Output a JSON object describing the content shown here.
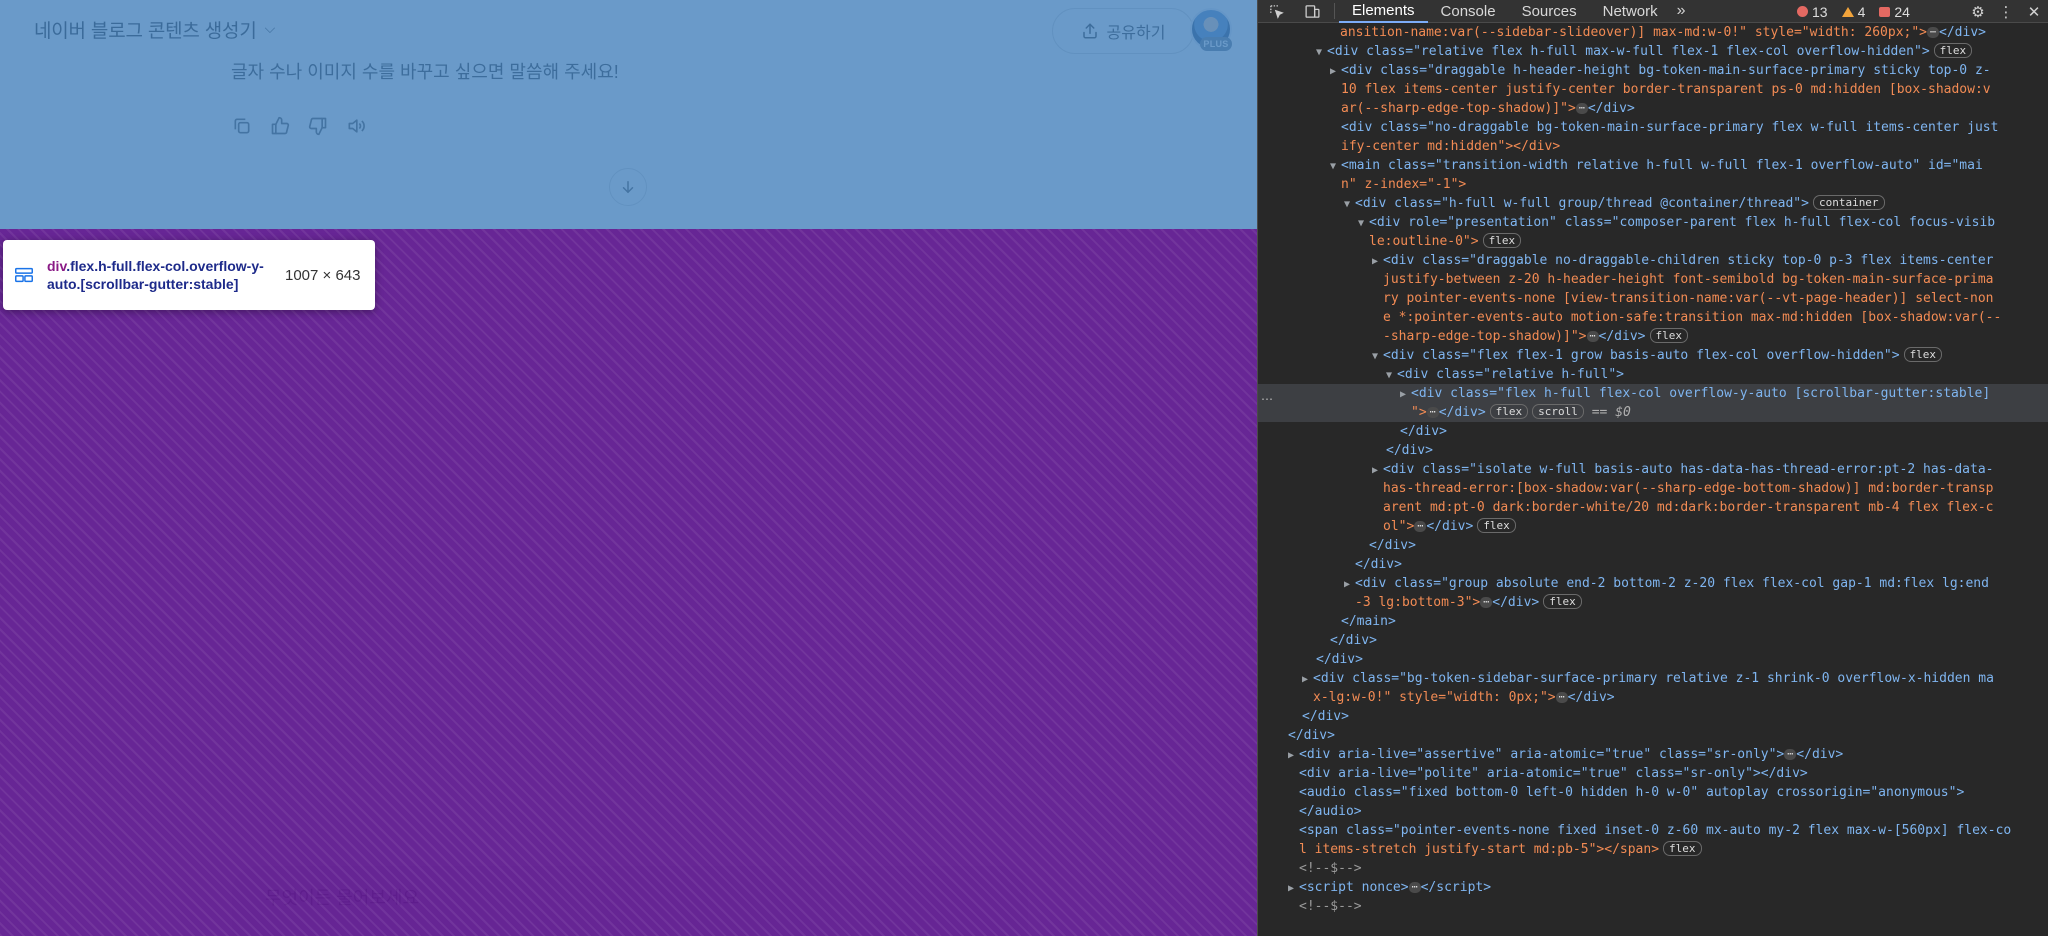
{
  "app": {
    "title": "네이버 블로그 콘텐츠 생성기",
    "share_label": "공유하기",
    "plan_badge": "PLUS",
    "assistant_message": "글자 수나 이미지 수를 바꾸고 싶으면 말씀해 주세요!",
    "composer_placeholder": "무엇이든 물어보세요"
  },
  "inspect_tooltip": {
    "tag": "div",
    "selector": ".flex.h-full.flex-col.overflow-y-auto.[scrollbar-gutter:stable]",
    "size": "1007 × 643"
  },
  "devtools": {
    "tabs": [
      "Elements",
      "Console",
      "Sources",
      "Network"
    ],
    "active_tab": "Elements",
    "errors": "13",
    "warnings": "4",
    "issues": "24",
    "selected_marker": "== $0",
    "dom_lines": [
      "ansition-name:var(--sidebar-slideover)] max-md:w-0!\" style=\"width: 260px;\">",
      "<div class=\"relative flex h-full max-w-full flex-1 flex-col overflow-hidden\">",
      "<div class=\"draggable h-header-height bg-token-main-surface-primary sticky top-0 z-",
      "10 flex items-center justify-center border-transparent ps-0 md:hidden [box-shadow:v",
      "ar(--sharp-edge-top-shadow)]\">",
      "<div class=\"no-draggable bg-token-main-surface-primary flex w-full items-center just",
      "ify-center md:hidden\"></div>",
      "<main class=\"transition-width relative h-full w-full flex-1 overflow-auto\" id=\"mai",
      "n\" z-index=\"-1\">",
      "<div class=\"h-full w-full group/thread @container/thread\">",
      "<div role=\"presentation\" class=\"composer-parent flex h-full flex-col focus-visib",
      "le:outline-0\">",
      "<div class=\"draggable no-draggable-children sticky top-0 p-3 flex items-center",
      "justify-between z-20 h-header-height font-semibold bg-token-main-surface-prima",
      "ry pointer-events-none [view-transition-name:var(--vt-page-header)] select-non",
      "e *:pointer-events-auto motion-safe:transition max-md:hidden [box-shadow:var(--",
      "-sharp-edge-top-shadow)]\">",
      "<div class=\"flex flex-1 grow basis-auto flex-col overflow-hidden\">",
      "<div class=\"relative h-full\">",
      "<div class=\"flex h-full flex-col overflow-y-auto [scrollbar-gutter:stable]",
      "\">",
      "</div>",
      "</div>",
      "<div class=\"isolate w-full basis-auto has-data-has-thread-error:pt-2 has-data-",
      "has-thread-error:[box-shadow:var(--sharp-edge-bottom-shadow)] md:border-transp",
      "arent md:pt-0 dark:border-white/20 md:dark:border-transparent mb-4 flex flex-c",
      "ol\">",
      "</div>",
      "</div>",
      "<div class=\"group absolute end-2 bottom-2 z-20 flex flex-col gap-1 md:flex lg:end",
      "-3 lg:bottom-3\">",
      "</main>",
      "</div>",
      "</div>",
      "<div class=\"bg-token-sidebar-surface-primary relative z-1 shrink-0 overflow-x-hidden ma",
      "x-lg:w-0!\" style=\"width: 0px;\">",
      "</div>",
      "</div>",
      "<div aria-live=\"assertive\" aria-atomic=\"true\" class=\"sr-only\">",
      "<div aria-live=\"polite\" aria-atomic=\"true\" class=\"sr-only\"></div>",
      "<audio class=\"fixed bottom-0 left-0 hidden h-0 w-0\" autoplay crossorigin=\"anonymous\">",
      "</audio>",
      "<span class=\"pointer-events-none fixed inset-0 z-60 mx-auto my-2 flex max-w-[560px] flex-co",
      "l items-stretch justify-start md:pb-5\"></span>",
      "<!--$-->",
      "<script nonce>",
      "<!--$-->"
    ],
    "badges": {
      "flex": "flex",
      "scroll": "scroll",
      "container": "container"
    }
  }
}
